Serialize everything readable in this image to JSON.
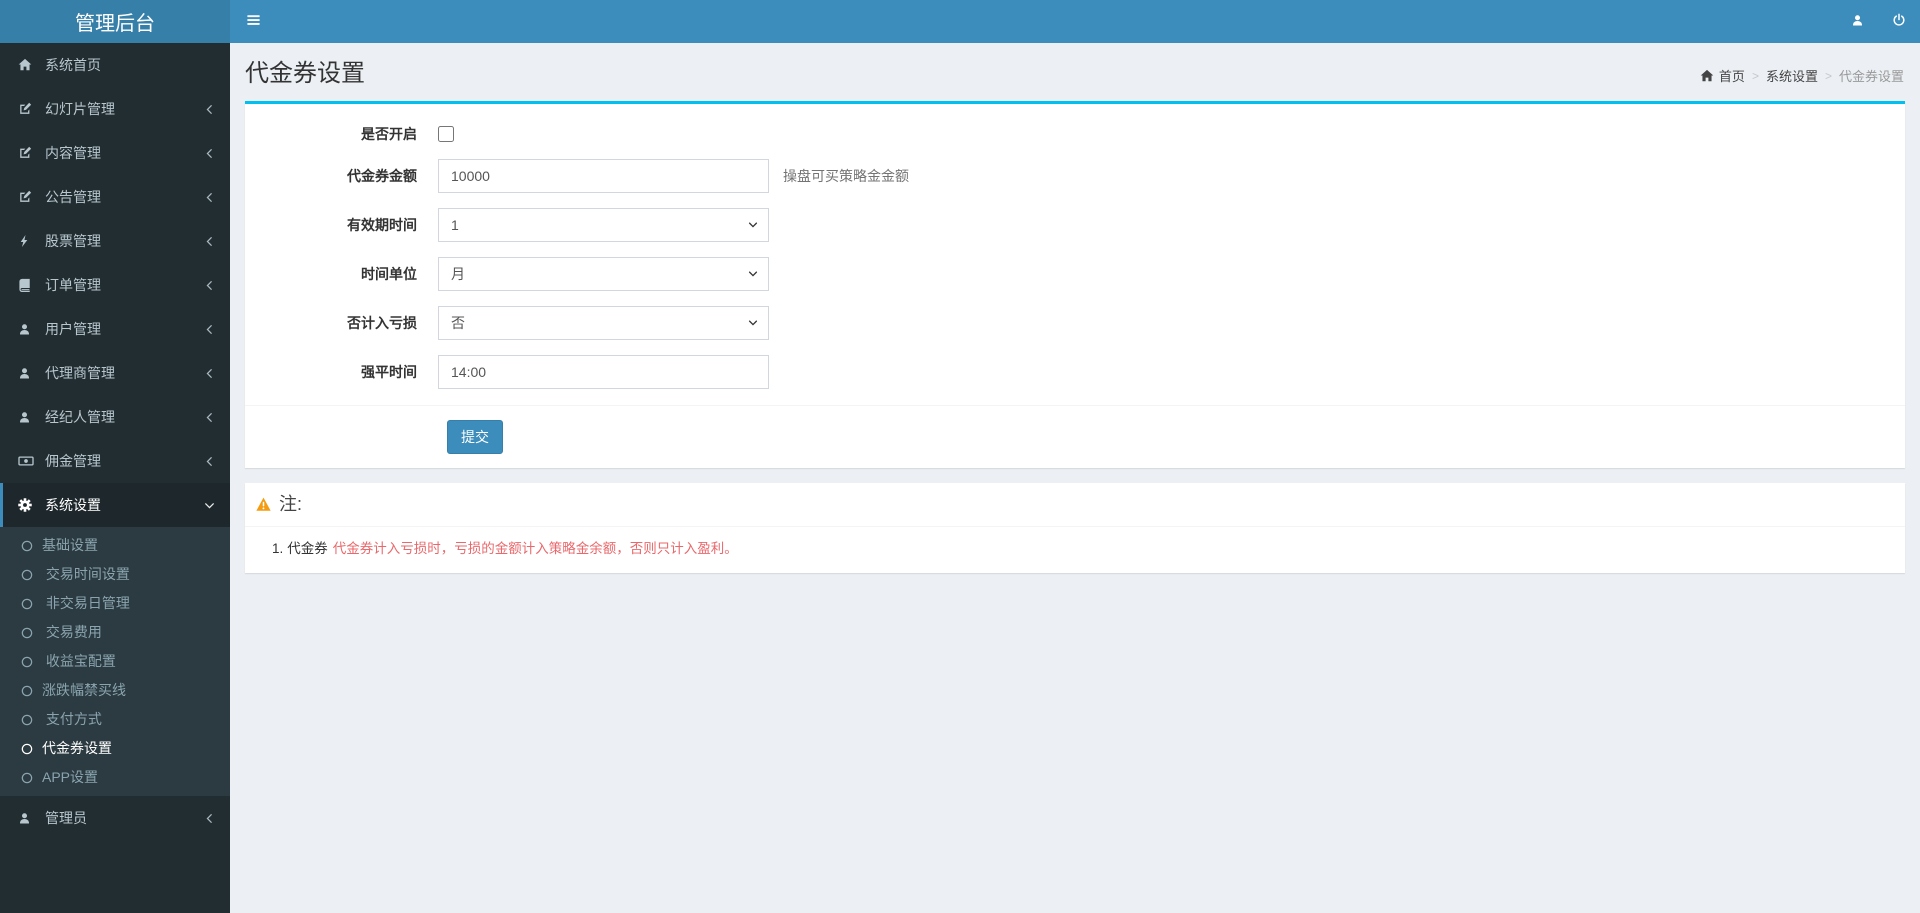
{
  "app_title": "管理后台",
  "navbar": {
    "hamburger_icon": "bars-icon",
    "user_icon": "user-icon",
    "power_icon": "power-icon"
  },
  "sidebar": {
    "items": [
      {
        "icon": "home-icon",
        "label": "系统首页"
      },
      {
        "icon": "edit-icon",
        "label": "幻灯片管理",
        "chevron": "left"
      },
      {
        "icon": "edit-icon",
        "label": "内容管理",
        "chevron": "left"
      },
      {
        "icon": "edit-icon",
        "label": "公告管理",
        "chevron": "left"
      },
      {
        "icon": "bolt-icon",
        "label": "股票管理",
        "chevron": "left"
      },
      {
        "icon": "book-icon",
        "label": "订单管理",
        "chevron": "left"
      },
      {
        "icon": "user-icon",
        "label": "用户管理",
        "chevron": "left"
      },
      {
        "icon": "user-icon",
        "label": "代理商管理",
        "chevron": "left"
      },
      {
        "icon": "user-icon",
        "label": "经纪人管理",
        "chevron": "left"
      },
      {
        "icon": "money-icon",
        "label": "佣金管理",
        "chevron": "left"
      },
      {
        "icon": "gear-icon",
        "label": "系统设置",
        "chevron": "down",
        "active": true,
        "submenu": [
          {
            "icon": "circle-icon",
            "label": "基础设置"
          },
          {
            "icon": "circle-icon",
            "label": " 交易时间设置"
          },
          {
            "icon": "circle-icon",
            "label": " 非交易日管理"
          },
          {
            "icon": "circle-icon",
            "label": " 交易费用"
          },
          {
            "icon": "circle-icon",
            "label": " 收益宝配置"
          },
          {
            "icon": "circle-icon",
            "label": "涨跌幅禁买线"
          },
          {
            "icon": "circle-icon",
            "label": " 支付方式"
          },
          {
            "icon": "circle-icon",
            "label": "代金券设置",
            "active": true
          },
          {
            "icon": "circle-icon",
            "label": "APP设置"
          }
        ]
      },
      {
        "icon": "user-icon",
        "label": "管理员",
        "chevron": "left"
      }
    ]
  },
  "page": {
    "title": "代金券设置",
    "breadcrumb": {
      "home_icon": "home-icon",
      "home": "首页",
      "section": "系统设置",
      "current": "代金券设置",
      "separator": ">"
    }
  },
  "form": {
    "fields": [
      {
        "label": "是否开启",
        "type": "checkbox",
        "checked": false
      },
      {
        "label": "代金券金额",
        "type": "text",
        "value": "10000",
        "help": "操盘可买策略金金额"
      },
      {
        "label": "有效期时间",
        "type": "select",
        "value": "1"
      },
      {
        "label": "时间单位",
        "type": "select",
        "value": "月"
      },
      {
        "label": "否计入亏损",
        "type": "select",
        "value": "否"
      },
      {
        "label": "强平时间",
        "type": "text",
        "value": "14:00"
      }
    ],
    "submit_label": "提交"
  },
  "note": {
    "warning_icon": "warning-icon",
    "title": "注:",
    "items": [
      {
        "number": "1.",
        "prefix": "代金券",
        "highlight": "代金券计入亏损时，亏损的金额计入策略金余额，否则只计入盈利。"
      }
    ]
  },
  "colors": {
    "navbar_bg": "#3c8dbc",
    "logo_bg": "#367fa9",
    "sidebar_bg": "#222d32",
    "submenu_bg": "#2c3b41",
    "active_item_bg": "#1e282c",
    "accent_blue": "#3c8dbc",
    "box_top_border": "#00c0ef",
    "warning_orange": "#f39c12",
    "highlight_red": "#e9686b",
    "content_bg": "#ecf0f5"
  }
}
